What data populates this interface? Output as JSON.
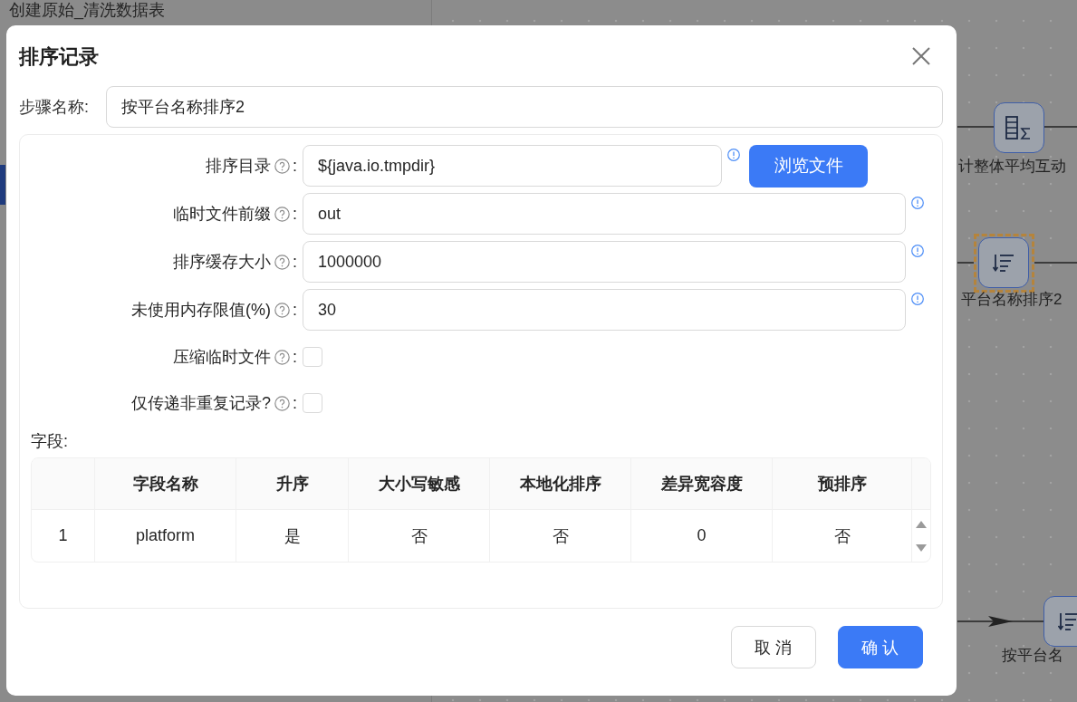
{
  "background": {
    "panel_title": "创建原始_清洗数据表"
  },
  "canvas": {
    "nodes": [
      {
        "kind": "aggregate",
        "label": "计整体平均互动",
        "selected": false
      },
      {
        "kind": "sort",
        "label": "平台名称排序2",
        "selected": true
      },
      {
        "kind": "sort",
        "label": "按平台名",
        "selected": false
      }
    ]
  },
  "dialog": {
    "title": "排序记录",
    "step_name": {
      "label": "步骤名称:",
      "value": "按平台名称排序2"
    },
    "fields": [
      {
        "kind": "text",
        "label": "排序目录",
        "suffix": ":",
        "value": "${java.io.tmpdir}",
        "button": "浏览文件"
      },
      {
        "kind": "text",
        "label": "临时文件前缀",
        "suffix": ":",
        "value": "out"
      },
      {
        "kind": "text",
        "label": "排序缓存大小",
        "suffix": ":",
        "value": "1000000"
      },
      {
        "kind": "text",
        "label": "未使用内存限值(%)",
        "suffix": ":",
        "value": "30"
      },
      {
        "kind": "checkbox",
        "label": "压缩临时文件",
        "suffix": ":",
        "checked": false
      },
      {
        "kind": "checkbox",
        "label": "仅传递非重复记录?",
        "suffix": ":",
        "checked": false
      }
    ],
    "table": {
      "label": "字段:",
      "columns": [
        "字段名称",
        "升序",
        "大小写敏感",
        "本地化排序",
        "差异宽容度",
        "预排序"
      ],
      "rows": [
        {
          "index": "1",
          "cells": [
            "platform",
            "是",
            "否",
            "否",
            "0",
            "否"
          ]
        }
      ]
    },
    "buttons": [
      {
        "kind": "secondary",
        "label": "取 消"
      },
      {
        "kind": "primary",
        "label": "确 认"
      }
    ]
  }
}
